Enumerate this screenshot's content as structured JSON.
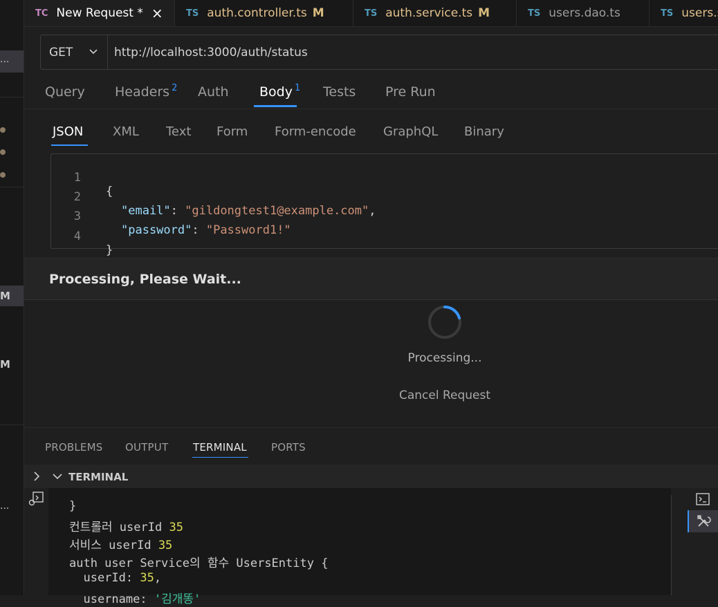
{
  "tabs": [
    {
      "icon": "TC",
      "label": "New Request *",
      "close": "×",
      "mod": ""
    },
    {
      "icon": "TS",
      "label": "auth.controller.ts",
      "mod": "M"
    },
    {
      "icon": "TS",
      "label": "auth.service.ts",
      "mod": "M"
    },
    {
      "icon": "TS",
      "label": "users.dao.ts",
      "mod": ""
    },
    {
      "icon": "TS",
      "label": "users.s",
      "mod": ""
    }
  ],
  "left_strip": {
    "ellipsis_top": "...",
    "markers": [
      "M",
      "M"
    ],
    "ellipsis_bottom": "..."
  },
  "request": {
    "method": "GET",
    "method_chevron": "⌄",
    "url": "http://localhost:3000/auth/status"
  },
  "request_tabs": [
    {
      "label": "Query",
      "badge": ""
    },
    {
      "label": "Headers",
      "badge": "2"
    },
    {
      "label": "Auth",
      "badge": ""
    },
    {
      "label": "Body",
      "badge": "1"
    },
    {
      "label": "Tests",
      "badge": ""
    },
    {
      "label": "Pre Run",
      "badge": ""
    }
  ],
  "body_format_tabs": [
    "JSON",
    "XML",
    "Text",
    "Form",
    "Form-encode",
    "GraphQL",
    "Binary"
  ],
  "editor": {
    "line_numbers": [
      "1",
      "2",
      "3",
      "4"
    ],
    "lines": {
      "open": "{",
      "k1": "\"email\"",
      "v1": "\"gildongtest1@example.com\"",
      "k2": "\"password\"",
      "v2": "\"Password1!\"",
      "close": "}"
    }
  },
  "processing": {
    "header": "Processing, Please Wait...",
    "status": "Processing...",
    "cancel_label": "Cancel Request"
  },
  "panel_tabs": [
    "PROBLEMS",
    "OUTPUT",
    "TERMINAL",
    "PORTS"
  ],
  "terminal": {
    "title": "TERMINAL",
    "expand_chevron": "›",
    "collapse_chevron": "⌄",
    "lines": {
      "l1": "}",
      "l2_text": "컨트롤러 userId ",
      "l2_num": "35",
      "l3_text": "서비스 userId ",
      "l3_num": "35",
      "l4": "auth user Service의 함수 UsersEntity {",
      "l5_text": "  userId: ",
      "l5_num": "35",
      "l5_end": ",",
      "l6_text": "  username: ",
      "l6_str": "'김개똥'"
    }
  },
  "colors": {
    "accent": "#3794ff",
    "background": "#1f1f1f",
    "tab_ts_icon": "#519aba",
    "tab_tc_icon": "#c586c0",
    "modified": "#d7ba7d"
  }
}
